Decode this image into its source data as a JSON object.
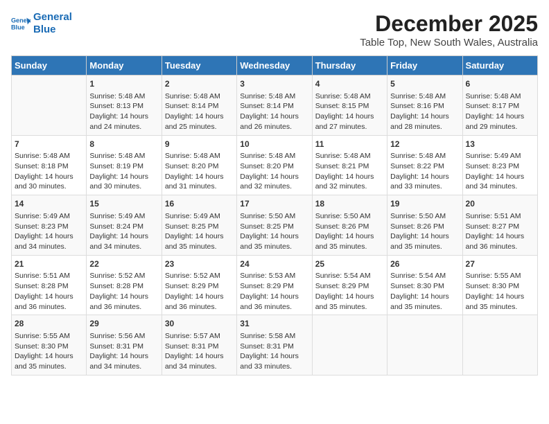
{
  "logo": {
    "line1": "General",
    "line2": "Blue"
  },
  "title": "December 2025",
  "subtitle": "Table Top, New South Wales, Australia",
  "days_of_week": [
    "Sunday",
    "Monday",
    "Tuesday",
    "Wednesday",
    "Thursday",
    "Friday",
    "Saturday"
  ],
  "weeks": [
    [
      {
        "day": "",
        "content": ""
      },
      {
        "day": "1",
        "content": "Sunrise: 5:48 AM\nSunset: 8:13 PM\nDaylight: 14 hours\nand 24 minutes."
      },
      {
        "day": "2",
        "content": "Sunrise: 5:48 AM\nSunset: 8:14 PM\nDaylight: 14 hours\nand 25 minutes."
      },
      {
        "day": "3",
        "content": "Sunrise: 5:48 AM\nSunset: 8:14 PM\nDaylight: 14 hours\nand 26 minutes."
      },
      {
        "day": "4",
        "content": "Sunrise: 5:48 AM\nSunset: 8:15 PM\nDaylight: 14 hours\nand 27 minutes."
      },
      {
        "day": "5",
        "content": "Sunrise: 5:48 AM\nSunset: 8:16 PM\nDaylight: 14 hours\nand 28 minutes."
      },
      {
        "day": "6",
        "content": "Sunrise: 5:48 AM\nSunset: 8:17 PM\nDaylight: 14 hours\nand 29 minutes."
      }
    ],
    [
      {
        "day": "7",
        "content": "Sunrise: 5:48 AM\nSunset: 8:18 PM\nDaylight: 14 hours\nand 30 minutes."
      },
      {
        "day": "8",
        "content": "Sunrise: 5:48 AM\nSunset: 8:19 PM\nDaylight: 14 hours\nand 30 minutes."
      },
      {
        "day": "9",
        "content": "Sunrise: 5:48 AM\nSunset: 8:20 PM\nDaylight: 14 hours\nand 31 minutes."
      },
      {
        "day": "10",
        "content": "Sunrise: 5:48 AM\nSunset: 8:20 PM\nDaylight: 14 hours\nand 32 minutes."
      },
      {
        "day": "11",
        "content": "Sunrise: 5:48 AM\nSunset: 8:21 PM\nDaylight: 14 hours\nand 32 minutes."
      },
      {
        "day": "12",
        "content": "Sunrise: 5:48 AM\nSunset: 8:22 PM\nDaylight: 14 hours\nand 33 minutes."
      },
      {
        "day": "13",
        "content": "Sunrise: 5:49 AM\nSunset: 8:23 PM\nDaylight: 14 hours\nand 34 minutes."
      }
    ],
    [
      {
        "day": "14",
        "content": "Sunrise: 5:49 AM\nSunset: 8:23 PM\nDaylight: 14 hours\nand 34 minutes."
      },
      {
        "day": "15",
        "content": "Sunrise: 5:49 AM\nSunset: 8:24 PM\nDaylight: 14 hours\nand 34 minutes."
      },
      {
        "day": "16",
        "content": "Sunrise: 5:49 AM\nSunset: 8:25 PM\nDaylight: 14 hours\nand 35 minutes."
      },
      {
        "day": "17",
        "content": "Sunrise: 5:50 AM\nSunset: 8:25 PM\nDaylight: 14 hours\nand 35 minutes."
      },
      {
        "day": "18",
        "content": "Sunrise: 5:50 AM\nSunset: 8:26 PM\nDaylight: 14 hours\nand 35 minutes."
      },
      {
        "day": "19",
        "content": "Sunrise: 5:50 AM\nSunset: 8:26 PM\nDaylight: 14 hours\nand 35 minutes."
      },
      {
        "day": "20",
        "content": "Sunrise: 5:51 AM\nSunset: 8:27 PM\nDaylight: 14 hours\nand 36 minutes."
      }
    ],
    [
      {
        "day": "21",
        "content": "Sunrise: 5:51 AM\nSunset: 8:28 PM\nDaylight: 14 hours\nand 36 minutes."
      },
      {
        "day": "22",
        "content": "Sunrise: 5:52 AM\nSunset: 8:28 PM\nDaylight: 14 hours\nand 36 minutes."
      },
      {
        "day": "23",
        "content": "Sunrise: 5:52 AM\nSunset: 8:29 PM\nDaylight: 14 hours\nand 36 minutes."
      },
      {
        "day": "24",
        "content": "Sunrise: 5:53 AM\nSunset: 8:29 PM\nDaylight: 14 hours\nand 36 minutes."
      },
      {
        "day": "25",
        "content": "Sunrise: 5:54 AM\nSunset: 8:29 PM\nDaylight: 14 hours\nand 35 minutes."
      },
      {
        "day": "26",
        "content": "Sunrise: 5:54 AM\nSunset: 8:30 PM\nDaylight: 14 hours\nand 35 minutes."
      },
      {
        "day": "27",
        "content": "Sunrise: 5:55 AM\nSunset: 8:30 PM\nDaylight: 14 hours\nand 35 minutes."
      }
    ],
    [
      {
        "day": "28",
        "content": "Sunrise: 5:55 AM\nSunset: 8:30 PM\nDaylight: 14 hours\nand 35 minutes."
      },
      {
        "day": "29",
        "content": "Sunrise: 5:56 AM\nSunset: 8:31 PM\nDaylight: 14 hours\nand 34 minutes."
      },
      {
        "day": "30",
        "content": "Sunrise: 5:57 AM\nSunset: 8:31 PM\nDaylight: 14 hours\nand 34 minutes."
      },
      {
        "day": "31",
        "content": "Sunrise: 5:58 AM\nSunset: 8:31 PM\nDaylight: 14 hours\nand 33 minutes."
      },
      {
        "day": "",
        "content": ""
      },
      {
        "day": "",
        "content": ""
      },
      {
        "day": "",
        "content": ""
      }
    ]
  ]
}
